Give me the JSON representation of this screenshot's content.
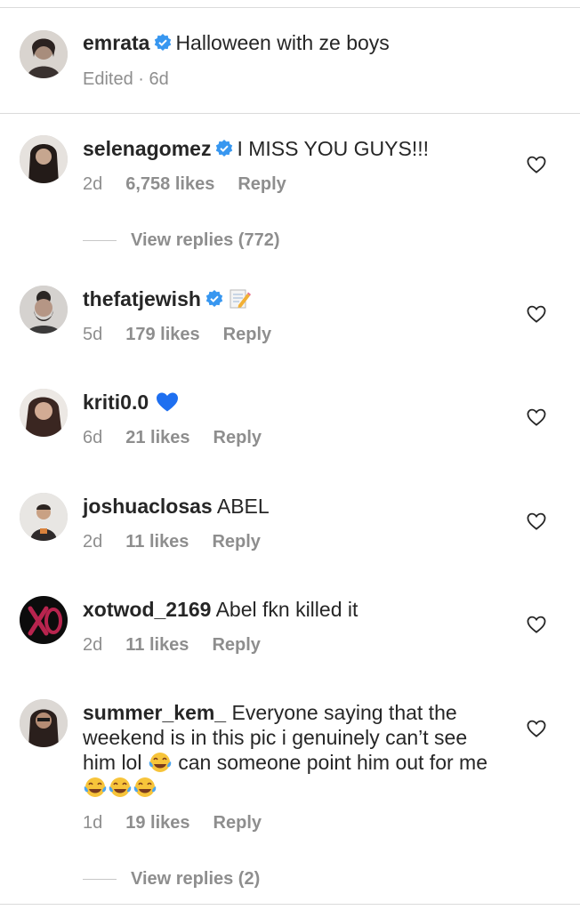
{
  "post": {
    "username": "emrata",
    "caption": "Halloween with ze boys",
    "meta": "Edited · 6d"
  },
  "comments": [
    {
      "username": "selenagomez",
      "text": "I MISS YOU GUYS!!!",
      "time": "2d",
      "likes": "6,758 likes",
      "reply": "Reply",
      "view_replies": "View replies (772)"
    },
    {
      "username": "thefatjewish",
      "text": "",
      "emoji": "memo",
      "time": "5d",
      "likes": "179 likes",
      "reply": "Reply"
    },
    {
      "username": "kriti0.0",
      "text": "",
      "emoji": "blue-heart",
      "time": "6d",
      "likes": "21 likes",
      "reply": "Reply"
    },
    {
      "username": "joshuaclosas",
      "text": "ABEL",
      "time": "2d",
      "likes": "11 likes",
      "reply": "Reply"
    },
    {
      "username": "xotwod_2169",
      "text": "Abel fkn killed it",
      "time": "2d",
      "likes": "11 likes",
      "reply": "Reply"
    },
    {
      "username": "summer_kem_",
      "text_part1": "Everyone saying that the weekend is in this pic i genuinely can’t see him lol",
      "text_part2": "can someone point him out for me",
      "emoji": "face-with-tears-of-joy",
      "time": "1d",
      "likes": "19 likes",
      "reply": "Reply",
      "view_replies": "View replies (2)"
    }
  ],
  "colors": {
    "verified": "#3897f0",
    "meta": "#8e8e8e",
    "text": "#262626"
  }
}
